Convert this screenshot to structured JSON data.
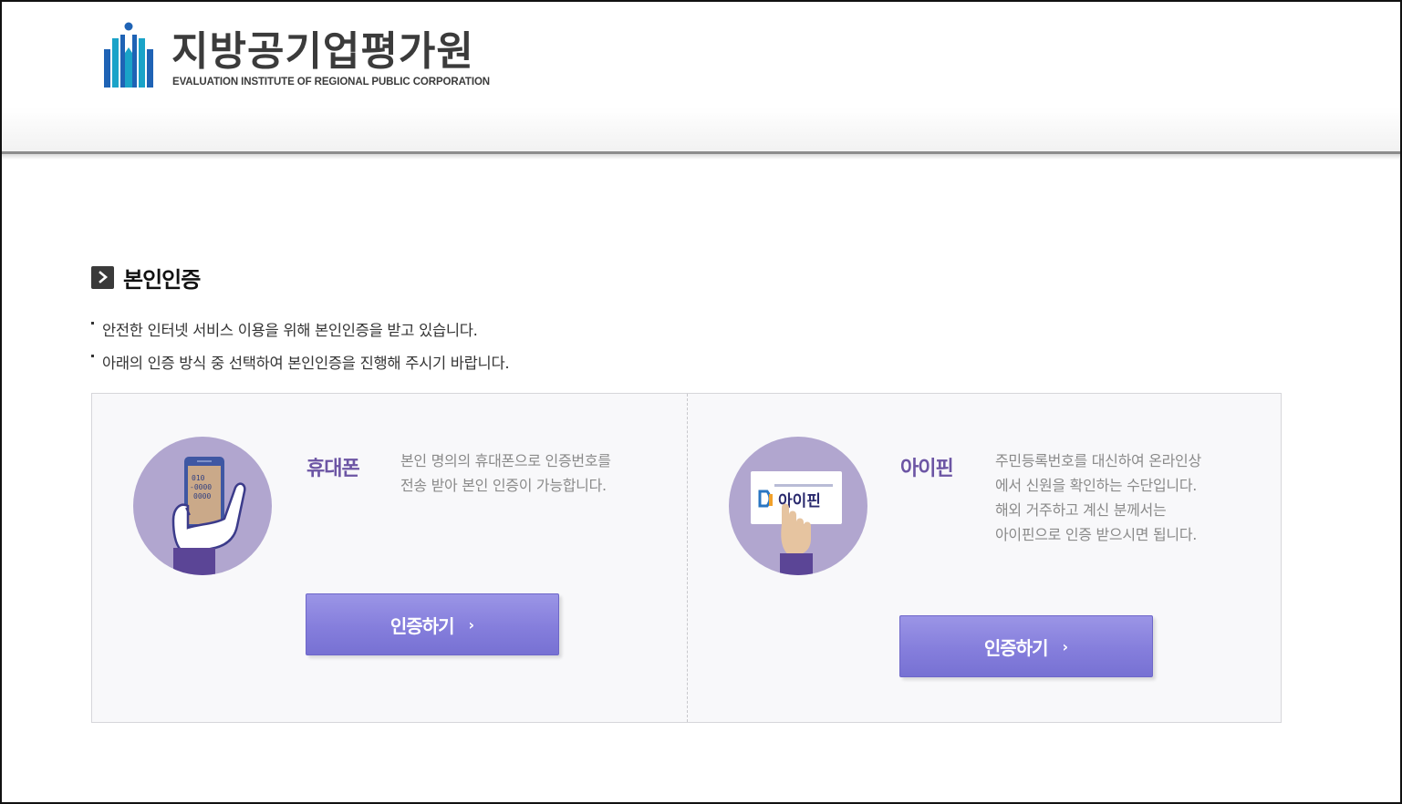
{
  "header": {
    "logo_korean": "지방공기업평가원",
    "logo_english": "EVALUATION INSTITUTE OF REGIONAL PUBLIC CORPORATION"
  },
  "section": {
    "title": "본인인증",
    "notes": [
      "안전한 인터넷 서비스 이용을 위해 본인인증을 받고 있습니다.",
      "아래의 인증 방식 중 선택하여 본인인증을 진행해 주시기 바랍니다."
    ]
  },
  "methods": {
    "phone": {
      "title": "휴대폰",
      "desc": [
        "본인 명의의 휴대폰으로 인증번호를",
        "전송 받아 본인 인증이 가능합니다."
      ],
      "button_label": "인증하기",
      "button_arrow": "›",
      "screen_digits": [
        "010",
        "-0000",
        "0000"
      ]
    },
    "ipin": {
      "title": "아이핀",
      "desc": [
        "주민등록번호를 대신하여 온라인상",
        "에서 신원을 확인하는 수단입니다.",
        "해외 거주하고 계신 분께서는",
        "아이핀으로 인증 받으시면 됩니다."
      ],
      "button_label": "인증하기",
      "button_arrow": "›",
      "card_logo_text": "아이핀"
    }
  },
  "colors": {
    "accent_purple": "#6c55a4",
    "button_top": "#9b95e6",
    "button_bottom": "#7771d3",
    "circle_bg": "#b1a6cf",
    "logo_blue": "#1f63b5",
    "logo_teal": "#1aa3c8"
  }
}
